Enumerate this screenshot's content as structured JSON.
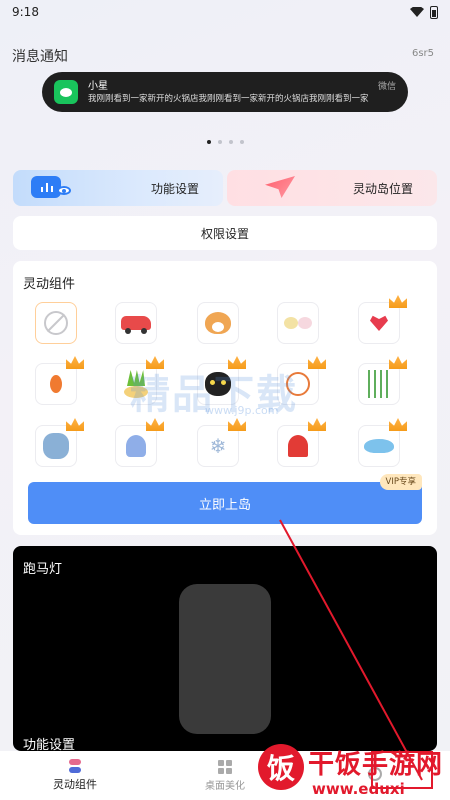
{
  "status_bar": {
    "time": "9:18"
  },
  "notice": {
    "title": "消息通知",
    "code": "6sr5"
  },
  "island": {
    "sender": "小星",
    "message": "我刚刚看到一家新开的火锅店我刚刚看到一家新开的火锅店我刚刚看到一家",
    "app": "微信"
  },
  "pager": {
    "count": 4,
    "active": 0
  },
  "tiles": {
    "function_settings": "功能设置",
    "island_position": "灵动岛位置"
  },
  "permission_button": "权限设置",
  "widgets": {
    "title": "灵动组件",
    "items": [
      {
        "icon": "none-icon",
        "vip": false,
        "selected": true
      },
      {
        "icon": "car-icon",
        "vip": false
      },
      {
        "icon": "corgi-icon",
        "vip": false
      },
      {
        "icon": "chicks-icon",
        "vip": false
      },
      {
        "icon": "heart-icon",
        "vip": true
      },
      {
        "icon": "lantern-icon",
        "vip": true
      },
      {
        "icon": "plant-icon",
        "vip": true
      },
      {
        "icon": "black-cat-icon",
        "vip": true
      },
      {
        "icon": "bike-icon",
        "vip": true
      },
      {
        "icon": "willow-icon",
        "vip": true
      },
      {
        "icon": "sloth-icon",
        "vip": true
      },
      {
        "icon": "jellyfish-icon",
        "vip": true
      },
      {
        "icon": "snowflake-icon",
        "vip": true
      },
      {
        "icon": "ghost-icon",
        "vip": true
      },
      {
        "icon": "whale-icon",
        "vip": true
      }
    ],
    "go_button": "立即上岛",
    "vip_badge": "VIP专享"
  },
  "marquee": {
    "title": "跑马灯",
    "function_settings": "功能设置"
  },
  "tabbar": {
    "tabs": [
      {
        "label": "灵动组件",
        "icon": "dynamic-widget-icon",
        "active": true
      },
      {
        "label": "桌面美化",
        "icon": "desktop-beautify-icon",
        "active": false
      },
      {
        "label": "",
        "icon": "profile-icon",
        "active": false
      }
    ]
  },
  "watermark": {
    "main": "精品下载",
    "sub": "www.j9p.com"
  },
  "brand": {
    "name": "干饭手游网",
    "url": "www.eduxi",
    "mark": "饭"
  },
  "colors": {
    "accent": "#4f8ef7",
    "wechat": "#19c45c",
    "vip": "#ffe7bd",
    "brand_red": "#e2192c"
  }
}
